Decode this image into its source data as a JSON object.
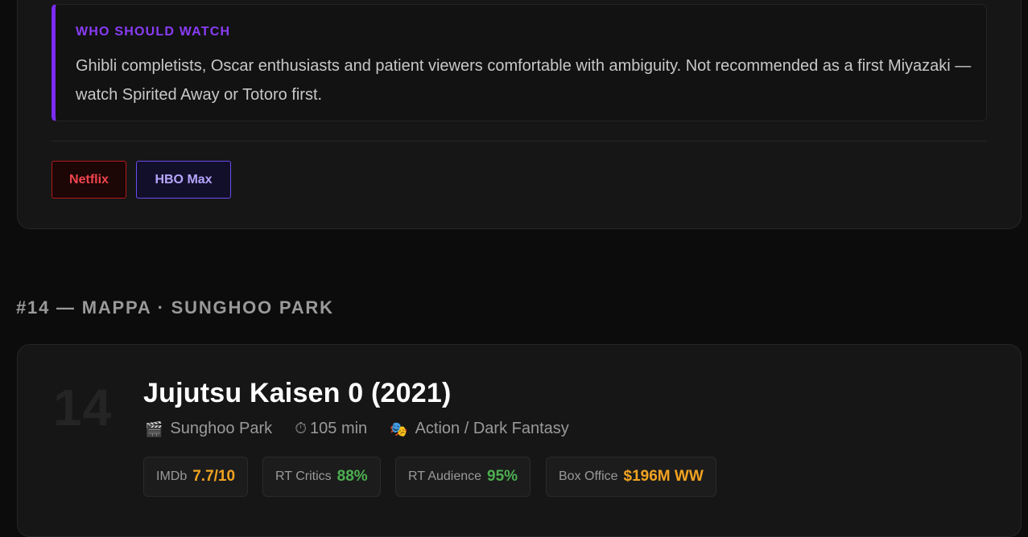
{
  "previous_entry": {
    "who_should_watch": {
      "label": "WHO SHOULD WATCH",
      "text": "Ghibli completists, Oscar enthusiasts and patient viewers comfortable with ambiguity. Not recommended as a first Miyazaki — watch Spirited Away or Totoro first."
    },
    "streaming": [
      {
        "label": "Netflix",
        "color": "#f0444c"
      },
      {
        "label": "HBO Max",
        "color": "#b7a6ff"
      }
    ]
  },
  "section_heading": "#14 — MAPPA · SUNGHOO PARK",
  "entry": {
    "rank": "14",
    "title": "Jujutsu Kaisen 0 (2021)",
    "meta": {
      "director": {
        "icon": "clapperboard-icon",
        "text": "Sunghoo Park"
      },
      "runtime": {
        "icon": "stopwatch-icon",
        "text": "105 min"
      },
      "genre": {
        "icon": "theater-masks-icon",
        "text": "Action / Dark Fantasy"
      }
    },
    "stats": [
      {
        "label": "IMDb",
        "value": "7.7/10",
        "color": "#f2a321"
      },
      {
        "label": "RT Critics",
        "value": "88%",
        "color": "#4caf50"
      },
      {
        "label": "RT Audience",
        "value": "95%",
        "color": "#4caf50"
      },
      {
        "label": "Box Office",
        "value": "$196M WW",
        "color": "#f2a321"
      }
    ]
  },
  "colors": {
    "accent_purple": "#7a2cf0",
    "background": "#0c0c0c",
    "card": "#161616"
  }
}
